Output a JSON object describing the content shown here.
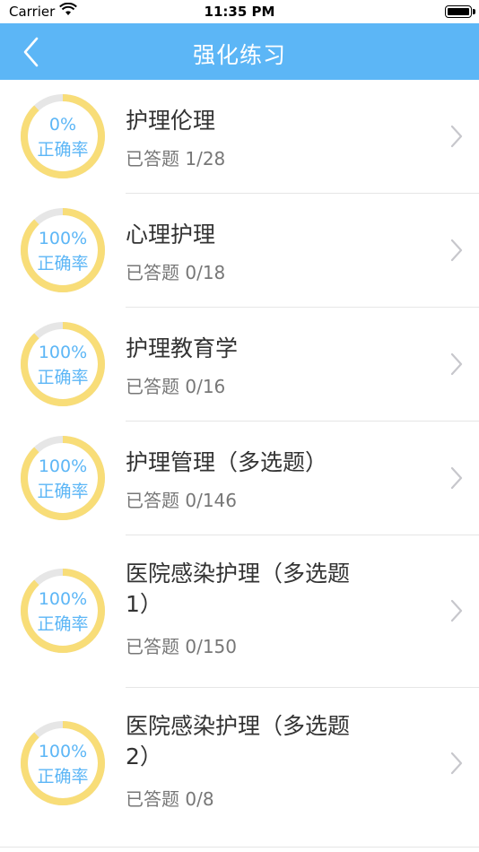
{
  "status_bar": {
    "carrier": "Carrier",
    "time": "11:35 PM"
  },
  "nav": {
    "title": "强化练习",
    "back_icon": "chevron-left-icon"
  },
  "colors": {
    "nav_bg": "#5cb6f6",
    "ring_fill": "#f8dd78",
    "ring_track": "#e6e6e6",
    "ring_text": "#5cb6f6"
  },
  "items": [
    {
      "percent": "0%",
      "accuracy_label": "正确率",
      "accuracy_fraction": 0.0,
      "name_lines": [
        "护理伦理"
      ],
      "answered": "已答题 1/28"
    },
    {
      "percent": "100%",
      "accuracy_label": "正确率",
      "accuracy_fraction": 1.0,
      "name_lines": [
        "心理护理"
      ],
      "answered": "已答题 0/18"
    },
    {
      "percent": "100%",
      "accuracy_label": "正确率",
      "accuracy_fraction": 1.0,
      "name_lines": [
        "护理教育学"
      ],
      "answered": "已答题 0/16"
    },
    {
      "percent": "100%",
      "accuracy_label": "正确率",
      "accuracy_fraction": 1.0,
      "name_lines": [
        "护理管理（多选题）"
      ],
      "answered": "已答题 0/146"
    },
    {
      "percent": "100%",
      "accuracy_label": "正确率",
      "accuracy_fraction": 1.0,
      "name_lines": [
        "医院感染护理（多选题",
        "1）"
      ],
      "answered": "已答题 0/150"
    },
    {
      "percent": "100%",
      "accuracy_label": "正确率",
      "accuracy_fraction": 1.0,
      "name_lines": [
        "医院感染护理（多选题",
        "2）"
      ],
      "answered": "已答题 0/8"
    }
  ]
}
